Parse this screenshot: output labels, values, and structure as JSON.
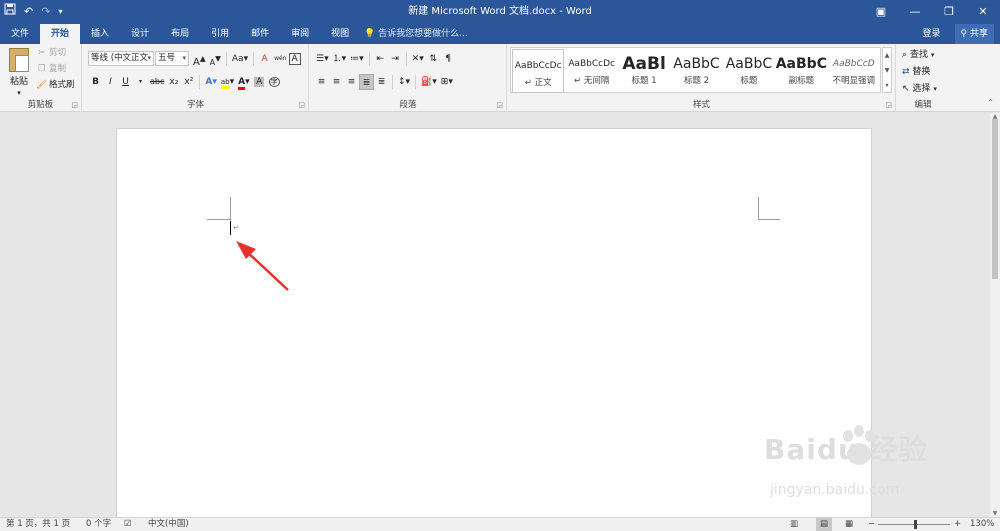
{
  "window": {
    "title": "新建 Microsoft Word 文档.docx - Word",
    "qat": {
      "save_icon": "save-icon",
      "undo_icon": "undo-icon",
      "redo_icon": "redo-icon",
      "customize_icon": "customize-qat-icon"
    },
    "controls": {
      "ribbon_options": "ribbon-display-options-icon",
      "minimize": "—",
      "restore": "❐",
      "close": "✕"
    }
  },
  "tabs": [
    "文件",
    "开始",
    "插入",
    "设计",
    "布局",
    "引用",
    "邮件",
    "审阅",
    "视图"
  ],
  "active_tab": "开始",
  "tell_me": "告诉我您想要做什么...",
  "account": {
    "signin": "登录",
    "share": "共享"
  },
  "ribbon": {
    "clipboard": {
      "label": "剪贴板",
      "paste": "粘贴",
      "cut": "剪切",
      "copy": "复制",
      "format_painter": "格式刷"
    },
    "font": {
      "label": "字体",
      "font_name": "等线 (中文正文",
      "font_size": "五号",
      "grow": "A",
      "shrink": "A",
      "case": "Aa",
      "clear": "A",
      "phonetic": "wén",
      "border": "A",
      "bold": "B",
      "italic": "I",
      "underline": "U",
      "strike": "abc",
      "subscript": "x₂",
      "superscript": "x²",
      "effects": "A",
      "highlight": "ab",
      "color": "A",
      "shading": "A",
      "enclose": "字"
    },
    "paragraph": {
      "label": "段落"
    },
    "styles": {
      "label": "样式",
      "items": [
        {
          "sample": "AaBbCcDc",
          "name": "↵ 正文"
        },
        {
          "sample": "AaBbCcDc",
          "name": "↵ 无间隔"
        },
        {
          "sample": "AaBl",
          "name": "标题 1"
        },
        {
          "sample": "AaBbC",
          "name": "标题 2"
        },
        {
          "sample": "AaBbC",
          "name": "标题"
        },
        {
          "sample": "AaBbC",
          "name": "副标题"
        },
        {
          "sample": "AaBbCcD",
          "name": "不明显强调"
        }
      ]
    },
    "editing": {
      "label": "编辑",
      "find": "查找",
      "replace": "替换",
      "select": "选择"
    }
  },
  "document": {
    "paragraph_mark": "↵"
  },
  "status": {
    "page": "第 1 页，共 1 页",
    "words": "0 个字",
    "language": "中文(中国)",
    "zoom": "130%",
    "zoom_minus": "−",
    "zoom_plus": "+"
  },
  "watermark": {
    "brand": "Baidu 经验",
    "url": "jingyan.baidu.com"
  },
  "colors": {
    "brand": "#2b579a",
    "ribbon": "#f3f3f3",
    "arrow": "#e8312c",
    "font_color": "#ff0000",
    "highlight": "#ffff00"
  }
}
